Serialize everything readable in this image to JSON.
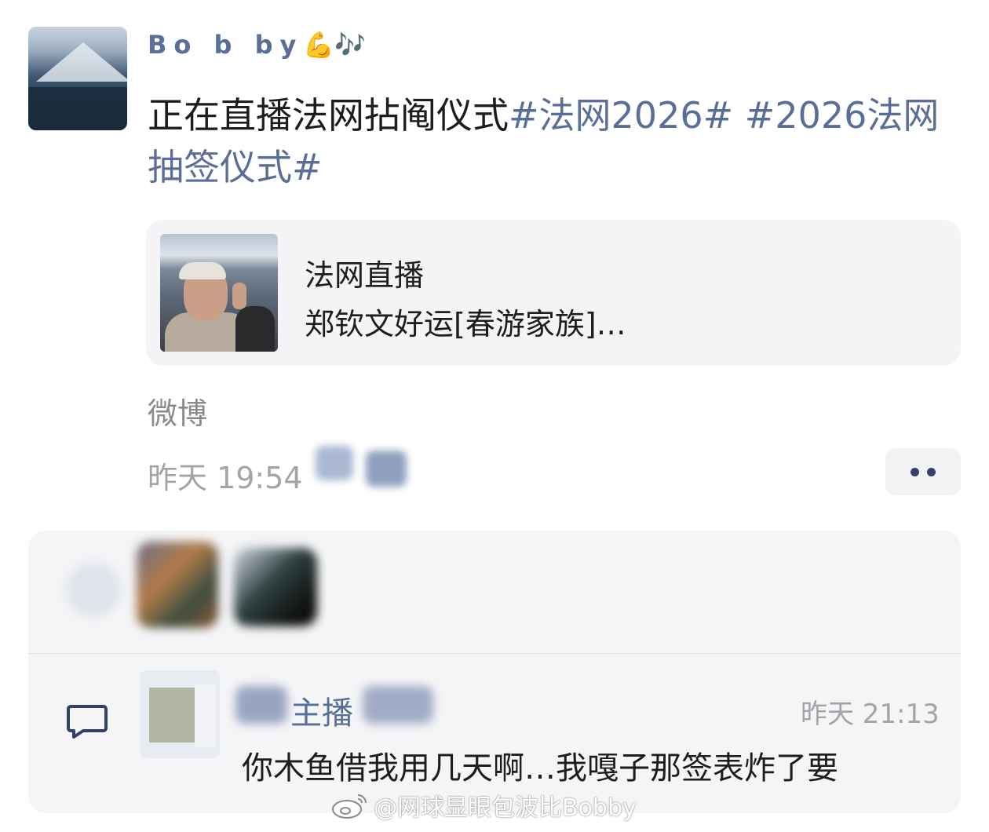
{
  "post": {
    "username": "Bo b by",
    "username_emoji": "💪🎶",
    "text_plain": "正在直播法网拈阄仪式",
    "hashtag1": "#法网2026#",
    "hashtag2": "#2026法网抽签仪式#"
  },
  "card": {
    "title": "法网直播",
    "subtitle": "郑钦文好运[春游家族]…"
  },
  "meta": {
    "source": "微博",
    "time": "昨天 19:54"
  },
  "comment": {
    "author": "主播",
    "time": "昨天 21:13",
    "text": "你木鱼借我用几天啊…我嘎子那签表炸了要"
  },
  "watermark": {
    "text": "@网球显眼包波比Bobby"
  },
  "colors": {
    "link": "#5a6f97",
    "panel_bg": "#f5f5f7",
    "muted": "#a4a4a8"
  }
}
